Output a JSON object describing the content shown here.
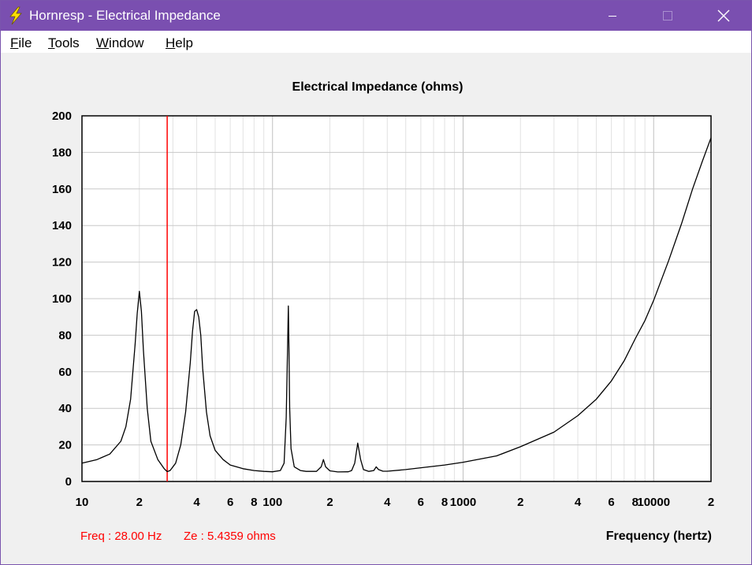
{
  "window": {
    "title": "Hornresp - Electrical Impedance",
    "app_icon": "lightning-bolt-icon",
    "controls": [
      "minimize-icon",
      "maximize-icon",
      "close-icon"
    ],
    "accent_color": "#7a4fb0"
  },
  "menu": {
    "items": [
      {
        "accel": "F",
        "rest": "ile"
      },
      {
        "accel": "T",
        "rest": "ools"
      },
      {
        "accel": "W",
        "rest": "indow"
      },
      {
        "accel": "H",
        "rest": "elp"
      }
    ]
  },
  "readout": {
    "freq": "Freq : 28.00 Hz",
    "ze": "Ze : 5.4359 ohms",
    "color": "#ff0000"
  },
  "chart_data": {
    "type": "line",
    "title": "Electrical Impedance (ohms)",
    "xlabel": "Frequency (hertz)",
    "ylabel": "",
    "x_scale": "log",
    "xlim": [
      10,
      20000
    ],
    "ylim": [
      0,
      200
    ],
    "y_ticks": [
      0,
      20,
      40,
      60,
      80,
      100,
      120,
      140,
      160,
      180,
      200
    ],
    "x_ticks": [
      {
        "value": 10,
        "label": "10"
      },
      {
        "value": 20,
        "label": "2"
      },
      {
        "value": 40,
        "label": "4"
      },
      {
        "value": 60,
        "label": "6"
      },
      {
        "value": 80,
        "label": "8"
      },
      {
        "value": 100,
        "label": "100"
      },
      {
        "value": 200,
        "label": "2"
      },
      {
        "value": 400,
        "label": "4"
      },
      {
        "value": 600,
        "label": "6"
      },
      {
        "value": 800,
        "label": "8"
      },
      {
        "value": 1000,
        "label": "1000"
      },
      {
        "value": 2000,
        "label": "2"
      },
      {
        "value": 4000,
        "label": "4"
      },
      {
        "value": 6000,
        "label": "6"
      },
      {
        "value": 8000,
        "label": "8"
      },
      {
        "value": 10000,
        "label": "10000"
      },
      {
        "value": 20000,
        "label": "2"
      }
    ],
    "grid": true,
    "series_color": "#000000",
    "marker": {
      "x": 28,
      "color": "#ff0000"
    },
    "x": [
      10,
      12,
      14,
      16,
      17,
      18,
      19,
      19.5,
      20,
      20.5,
      21,
      22,
      23,
      25,
      27,
      28,
      29,
      31,
      33,
      35,
      37,
      38,
      39,
      40,
      41,
      42,
      43,
      45,
      47,
      50,
      55,
      60,
      70,
      80,
      90,
      100,
      110,
      115,
      118,
      120,
      121,
      122,
      123,
      125,
      130,
      140,
      150,
      170,
      180,
      185,
      190,
      200,
      220,
      250,
      260,
      270,
      280,
      290,
      300,
      320,
      340,
      350,
      360,
      380,
      400,
      500,
      600,
      800,
      1000,
      1500,
      2000,
      3000,
      4000,
      5000,
      6000,
      7000,
      8000,
      9000,
      10000,
      12000,
      14000,
      16000,
      18000,
      20000
    ],
    "values": [
      10,
      12,
      15,
      22,
      30,
      45,
      75,
      92,
      104,
      93,
      72,
      40,
      22,
      12,
      7,
      5.4,
      6,
      10,
      20,
      38,
      65,
      82,
      93,
      94,
      90,
      80,
      62,
      38,
      25,
      17,
      12,
      9,
      7,
      6,
      5.5,
      5.3,
      6,
      10,
      35,
      75,
      96,
      72,
      40,
      18,
      8,
      6,
      5.5,
      5.5,
      8,
      12,
      8,
      5.8,
      5.2,
      5.3,
      6,
      10,
      21,
      12,
      6.5,
      5.5,
      6,
      8,
      6.5,
      5.6,
      5.6,
      6.5,
      7.5,
      9,
      10.5,
      14,
      19,
      27,
      36,
      45,
      55,
      66,
      78,
      88,
      99,
      121,
      141,
      160,
      175,
      188
    ]
  }
}
